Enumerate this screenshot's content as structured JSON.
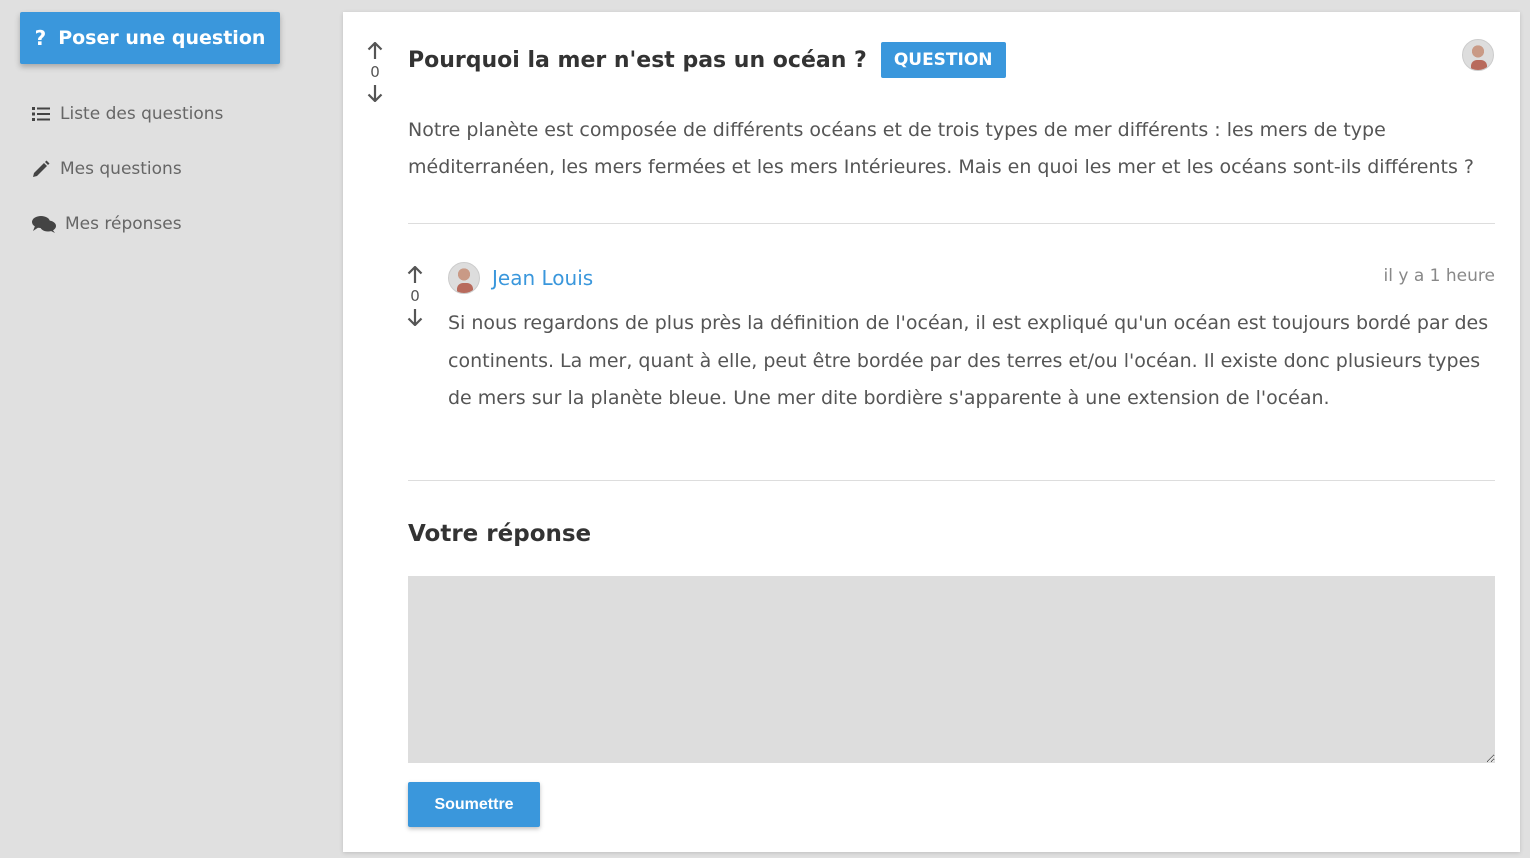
{
  "sidebar": {
    "ask_button": {
      "icon": "question-mark-icon",
      "symbol": "?",
      "label": "Poser une question"
    },
    "items": [
      {
        "icon": "list-icon",
        "label": "Liste des questions"
      },
      {
        "icon": "pencil-icon",
        "label": "Mes questions"
      },
      {
        "icon": "comments-icon",
        "label": "Mes réponses"
      }
    ]
  },
  "question": {
    "title": "Pourquoi la mer n'est pas un océan ?",
    "badge": "QUESTION",
    "votes": "0",
    "body": "Notre planète est composée de différents océans et de trois types de mer différents : les mers de type méditerranéen, les mers fermées et les mers Intérieures. Mais en quoi les mer et les océans sont-ils différents ?"
  },
  "answers": [
    {
      "author": "Jean Louis",
      "time": "il y a 1 heure",
      "votes": "0",
      "body": "Si nous regardons de plus près la définition de l'océan, il est expliqué qu'un océan est toujours bordé par des continents. La mer, quant à elle, peut être bordée par des terres et/ou l'océan. Il existe donc plusieurs types de mers sur la planète bleue. Une mer dite bordière s'apparente à une extension de l'océan."
    }
  ],
  "reply": {
    "heading": "Votre réponse",
    "value": "",
    "submit_label": "Soumettre"
  },
  "colors": {
    "accent": "#3a97dc",
    "background": "#e0e0e0",
    "panel": "#ffffff",
    "textarea": "#dddddd"
  }
}
